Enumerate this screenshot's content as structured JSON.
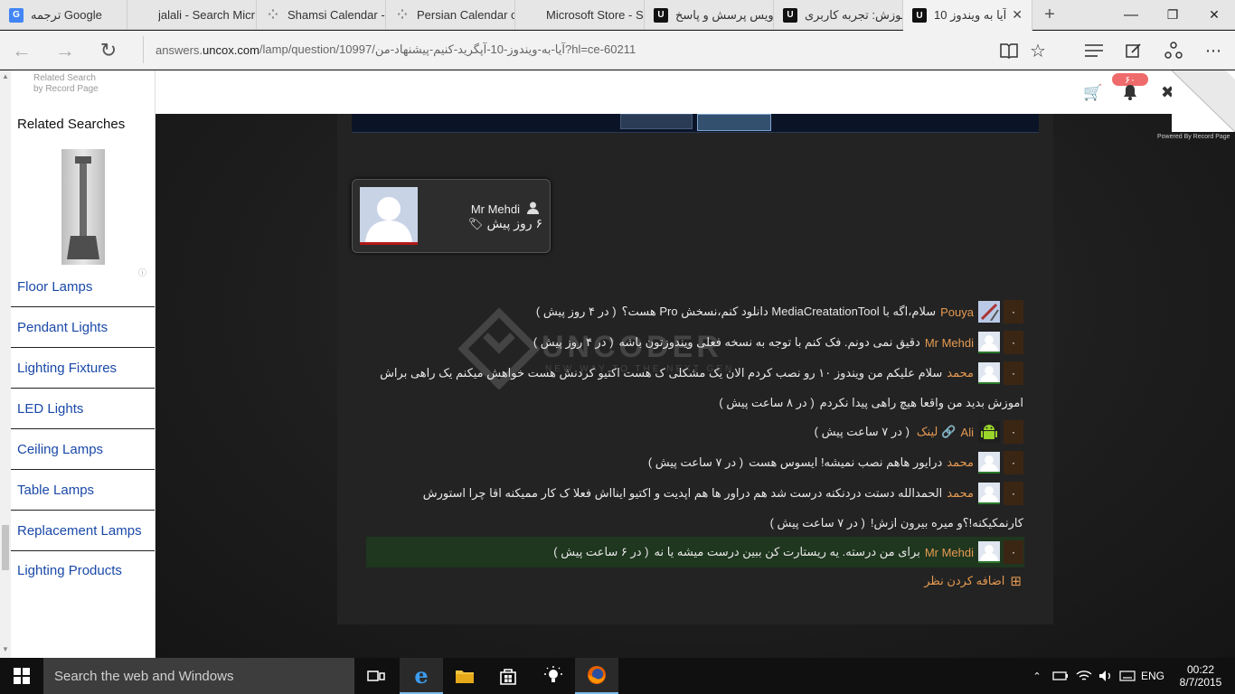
{
  "browser": {
    "tabs": [
      {
        "title": "ترجمه Google",
        "favicon": "google-translate-icon"
      },
      {
        "title": "jalali - Search Micr",
        "favicon": "microsoft-icon"
      },
      {
        "title": "Shamsi Calendar -",
        "favicon": "loading-dots-icon"
      },
      {
        "title": "Persian Calendar c",
        "favicon": "loading-dots-icon"
      },
      {
        "title": "Microsoft Store - S",
        "favicon": "microsoft-icon"
      },
      {
        "title": "سرویس پرسش و پاسخ",
        "favicon": "uncox-icon"
      },
      {
        "title": "آموزش: تجربه کاربری",
        "favicon": "uncox-icon"
      },
      {
        "title": "آیا به ویندوز 10",
        "favicon": "uncox-icon",
        "active": true
      }
    ],
    "url_prefix": "answers.",
    "url_domain": "uncox.com",
    "url_path": "/lamp/question/10997/آیا-به-ویندوز-10-آپگرید-کنیم-پیشنهاد-من?hl=ce-60211",
    "window_controls": {
      "minimize": "—",
      "maximize": "❐",
      "close": "✕"
    }
  },
  "left_panel": {
    "caption_line1": "Related Search",
    "caption_line2": "by Record Page",
    "heading": "Related Searches",
    "items": [
      "Floor Lamps",
      "Pendant Lights",
      "Lighting Fixtures",
      "LED Lights",
      "Ceiling Lamps",
      "Table Lamps",
      "Replacement Lamps",
      "Lighting Products"
    ]
  },
  "header": {
    "badge": "۶۰",
    "powered_by": "Powered By Record Page"
  },
  "author": {
    "name": "Mr Mehdi",
    "time": "۶ روز پیش"
  },
  "watermark": {
    "title": "UNCODER",
    "subtitle": "NEW WAY TO THE NEXT GEN"
  },
  "comments": [
    {
      "vote": "۰",
      "name": "Pouya",
      "avatar": "pouya-avatar",
      "text": "سلام،اگه با MediaCreatationTool دانلود کنم،نسخش Pro هست؟",
      "time": "( در ۴ روز پیش )"
    },
    {
      "vote": "۰",
      "name": "Mr Mehdi",
      "avatar": "default-avatar",
      "text": "دقیق نمی دونم. فک کنم با توجه به نسخه فعلی ویندوزتون باشه",
      "time": "( در ۴ روز پیش )"
    },
    {
      "vote": "۰",
      "name": "محمد",
      "avatar": "default-avatar",
      "text": "سلام علیکم من ویندوز ۱۰ رو نصب کردم الان یک مشکلی ک هست اکتیو کردنش هست خواهش میکنم یک راهی براش",
      "text2": "اموزش بدید من واقعا هیچ راهی پیدا نکردم",
      "time": "( در ۸ ساعت پیش )"
    },
    {
      "vote": "۰",
      "name": "Ali",
      "avatar": "android-avatar",
      "link": "لینک",
      "time": "( در ۷ ساعت پیش )"
    },
    {
      "vote": "۰",
      "name": "محمد",
      "avatar": "default-avatar",
      "text": "درایور هاهم نصب نمیشه! ایسوس هست",
      "time": "( در ۷ ساعت پیش )"
    },
    {
      "vote": "۰",
      "name": "محمد",
      "avatar": "default-avatar",
      "text": "الحمدالله دستت دردنکنه درست شد هم دراور ها هم اپدیت و اکتیو اینااش فعلا ک کار ممیکنه اقا چرا استورش",
      "text2": "کارنمکیکنه!؟و میره بیرون ازش!",
      "time": "( در ۷ ساعت پیش )"
    },
    {
      "vote": "۰",
      "name": "Mr Mehdi",
      "avatar": "default-avatar",
      "text": "برای من درسته. یه ریستارت کن ببین درست میشه یا نه",
      "time": "( در ۶ ساعت پیش )",
      "highlighted": true
    }
  ],
  "add_comment": "اضافه کردن نظر",
  "taskbar": {
    "search_placeholder": "Search the web and Windows",
    "language": "ENG",
    "time": "00:22",
    "date": "8/7/2015"
  },
  "colors": {
    "accent_orange": "#e59a52",
    "vote_bg": "#3b2614",
    "link_blue": "#1a49a8",
    "highlight_green": "#1f3a1f"
  }
}
